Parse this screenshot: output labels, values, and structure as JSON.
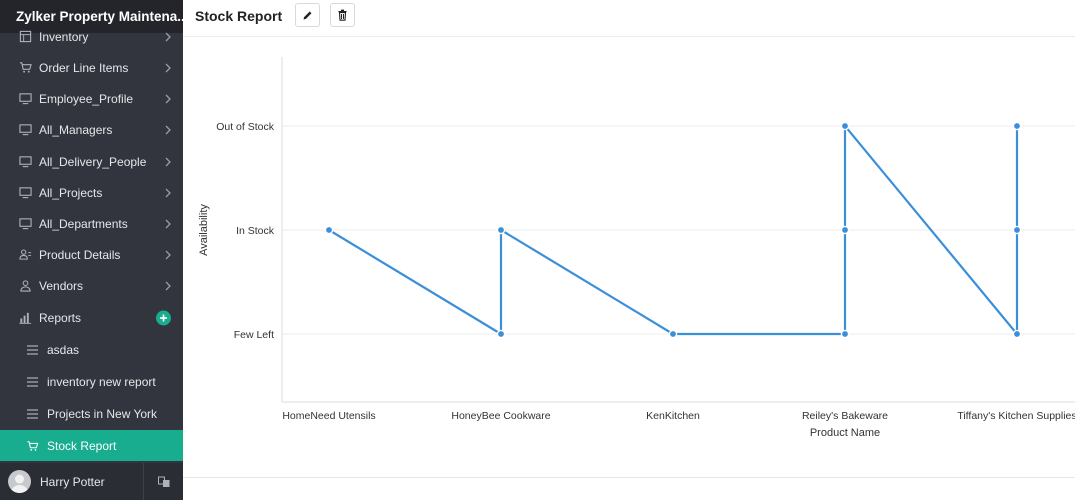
{
  "app": {
    "title": "Zylker Property Maintena..."
  },
  "sidebar": {
    "items": [
      {
        "label": "Inventory",
        "icon": "table-icon"
      },
      {
        "label": "Order Line Items",
        "icon": "cart-icon"
      },
      {
        "label": "Employee_Profile",
        "icon": "monitor-icon"
      },
      {
        "label": "All_Managers",
        "icon": "monitor-icon"
      },
      {
        "label": "All_Delivery_People",
        "icon": "monitor-icon"
      },
      {
        "label": "All_Projects",
        "icon": "monitor-icon"
      },
      {
        "label": "All_Departments",
        "icon": "monitor-icon"
      },
      {
        "label": "Product Details",
        "icon": "users-icon"
      },
      {
        "label": "Vendors",
        "icon": "user-icon"
      },
      {
        "label": "Reports",
        "icon": "chart-icon"
      }
    ],
    "reports": [
      {
        "label": "asdas",
        "icon": "list-icon"
      },
      {
        "label": "inventory new report",
        "icon": "list-icon"
      },
      {
        "label": "Projects in New York",
        "icon": "list-icon"
      },
      {
        "label": "Stock Report",
        "icon": "cart-icon",
        "active": true
      }
    ],
    "accent_color": "#17ad8e"
  },
  "user": {
    "name": "Harry Potter"
  },
  "header": {
    "title": "Stock Report",
    "edit_icon": "pencil-icon",
    "delete_icon": "trash-icon"
  },
  "chart_data": {
    "type": "line",
    "x_categories": [
      "HomeNeed Utensils",
      "HoneyBee Cookware",
      "KenKitchen",
      "Reiley's Bakeware",
      "Tiffany's Kitchen Supplies"
    ],
    "y_categories": [
      "Few Left",
      "In Stock",
      "Out of Stock"
    ],
    "points": [
      {
        "x": "HomeNeed Utensils",
        "y": "In Stock"
      },
      {
        "x": "HoneyBee Cookware",
        "y": "Few Left"
      },
      {
        "x": "HoneyBee Cookware",
        "y": "In Stock"
      },
      {
        "x": "KenKitchen",
        "y": "Few Left"
      },
      {
        "x": "Reiley's Bakeware",
        "y": "Few Left"
      },
      {
        "x": "Reiley's Bakeware",
        "y": "In Stock"
      },
      {
        "x": "Reiley's Bakeware",
        "y": "Out of Stock"
      },
      {
        "x": "Tiffany's Kitchen Supplies",
        "y": "Few Left"
      },
      {
        "x": "Tiffany's Kitchen Supplies",
        "y": "In Stock"
      },
      {
        "x": "Tiffany's Kitchen Supplies",
        "y": "Out of Stock"
      }
    ],
    "xlabel": "Product Name",
    "ylabel": "Availability",
    "grid": true,
    "line_color": "#3b8fd9"
  }
}
